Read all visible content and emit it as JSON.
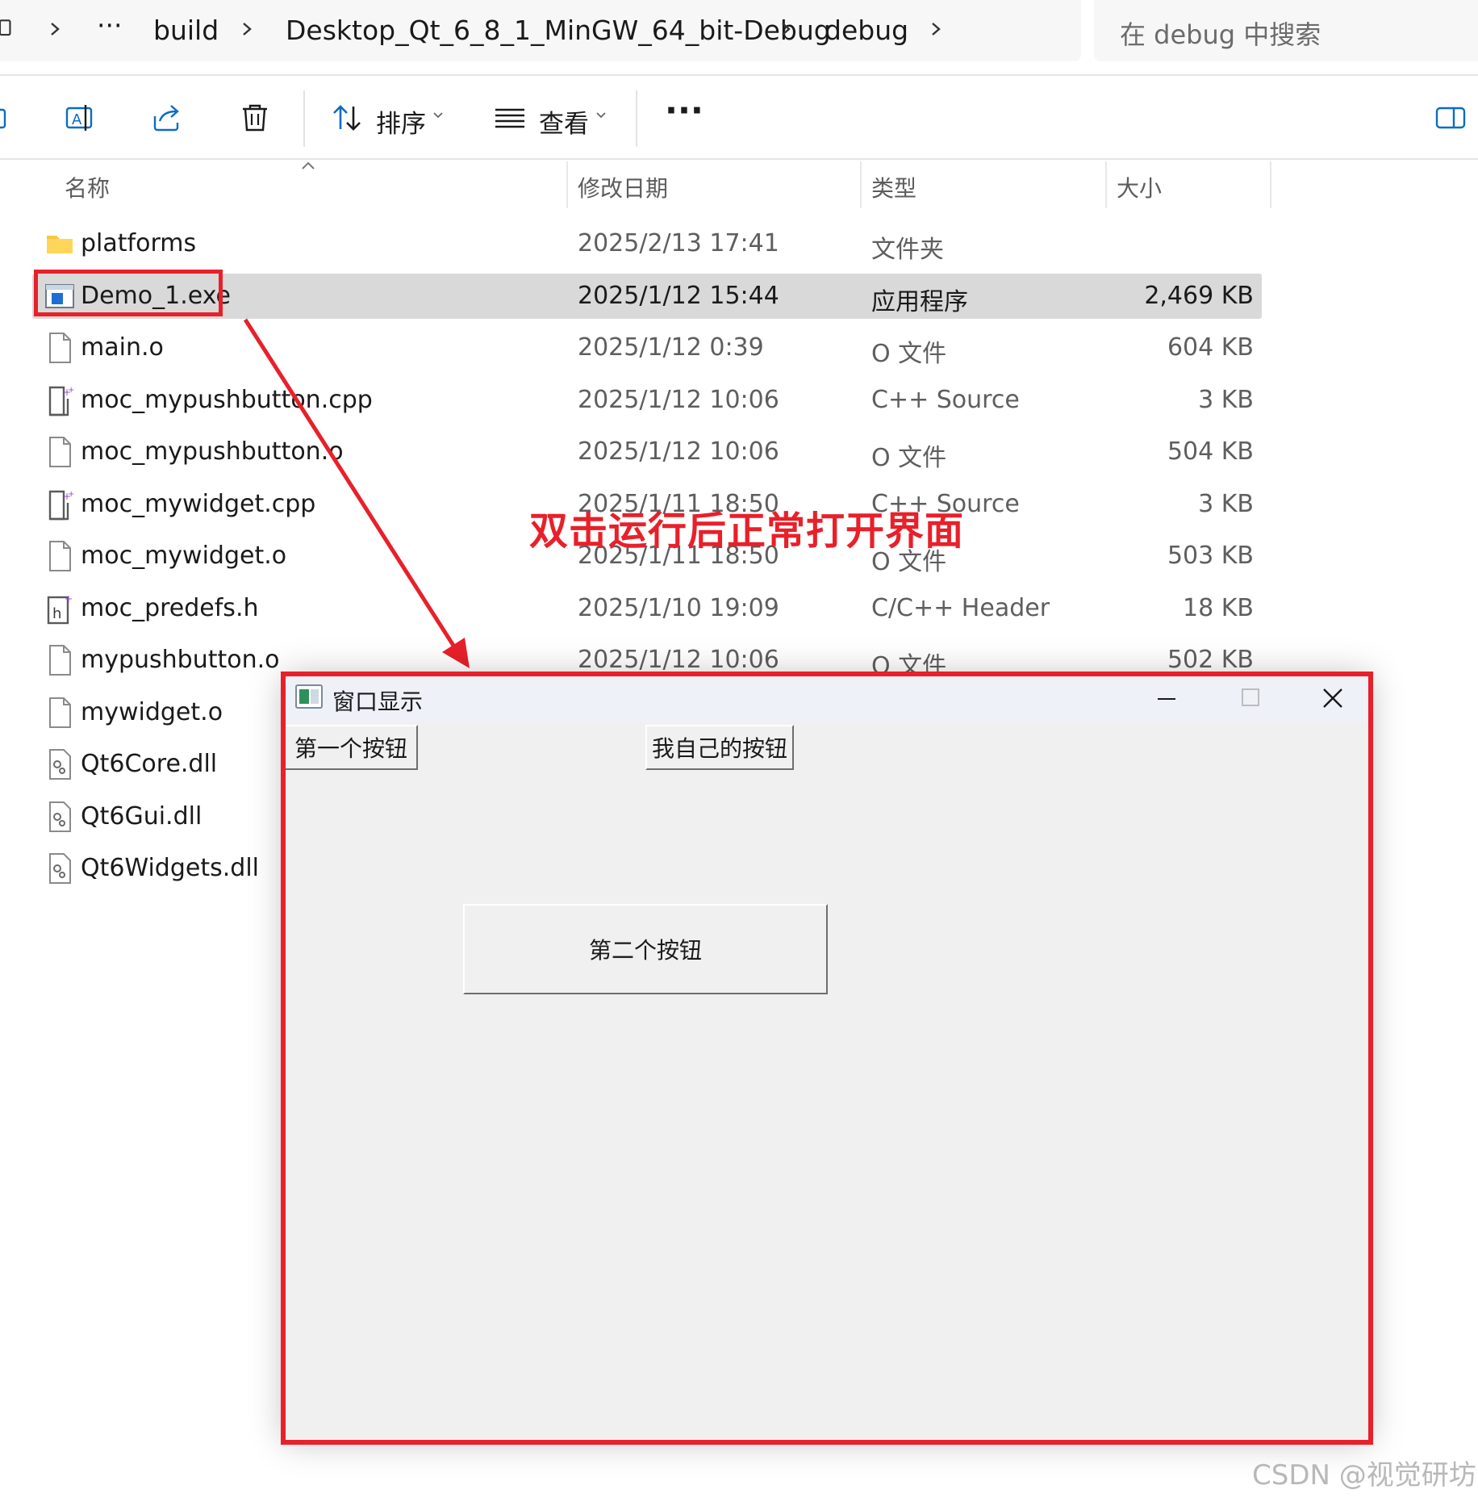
{
  "breadcrumb": {
    "ellipsis": "···",
    "items": [
      "build",
      "Desktop_Qt_6_8_1_MinGW_64_bit-Debug",
      "debug"
    ]
  },
  "search": {
    "placeholder": "在 debug 中搜索"
  },
  "toolbar": {
    "sort_label": "排序",
    "view_label": "查看",
    "more_label": "···",
    "icons": [
      "rename-icon",
      "share-icon",
      "delete-icon",
      "sort-icon",
      "view-icon",
      "details-pane-icon"
    ]
  },
  "columns": {
    "name": "名称",
    "date": "修改日期",
    "type": "类型",
    "size": "大小"
  },
  "files": [
    {
      "name": "platforms",
      "date": "2025/2/13 17:41",
      "type": "文件夹",
      "size": "",
      "icon": "folder"
    },
    {
      "name": "Demo_1.exe",
      "date": "2025/1/12 15:44",
      "type": "应用程序",
      "size": "2,469 KB",
      "icon": "exe",
      "selected": true
    },
    {
      "name": "main.o",
      "date": "2025/1/12 0:39",
      "type": "O 文件",
      "size": "604 KB",
      "icon": "file"
    },
    {
      "name": "moc_mypushbutton.cpp",
      "date": "2025/1/12 10:06",
      "type": "C++ Source",
      "size": "3 KB",
      "icon": "cpp"
    },
    {
      "name": "moc_mypushbutton.o",
      "date": "2025/1/12 10:06",
      "type": "O 文件",
      "size": "504 KB",
      "icon": "file"
    },
    {
      "name": "moc_mywidget.cpp",
      "date": "2025/1/11 18:50",
      "type": "C++ Source",
      "size": "3 KB",
      "icon": "cpp"
    },
    {
      "name": "moc_mywidget.o",
      "date": "2025/1/11 18:50",
      "type": "O 文件",
      "size": "503 KB",
      "icon": "file"
    },
    {
      "name": "moc_predefs.h",
      "date": "2025/1/10 19:09",
      "type": "C/C++ Header",
      "size": "18 KB",
      "icon": "header"
    },
    {
      "name": "mypushbutton.o",
      "date": "2025/1/12 10:06",
      "type": "O 文件",
      "size": "502 KB",
      "icon": "file"
    },
    {
      "name": "mywidget.o",
      "date": "",
      "type": "",
      "size": "",
      "icon": "file"
    },
    {
      "name": "Qt6Core.dll",
      "date": "",
      "type": "",
      "size": "",
      "icon": "dll"
    },
    {
      "name": "Qt6Gui.dll",
      "date": "",
      "type": "",
      "size": "",
      "icon": "dll"
    },
    {
      "name": "Qt6Widgets.dll",
      "date": "",
      "type": "",
      "size": "",
      "icon": "dll"
    }
  ],
  "annotation": {
    "text": "双击运行后正常打开界面",
    "color": "#e8202a"
  },
  "qt_window": {
    "title": "窗口显示",
    "button1": "第一个按钮",
    "button_mine": "我自己的按钮",
    "button2": "第二个按钮"
  },
  "watermark": "CSDN @视觉研坊"
}
